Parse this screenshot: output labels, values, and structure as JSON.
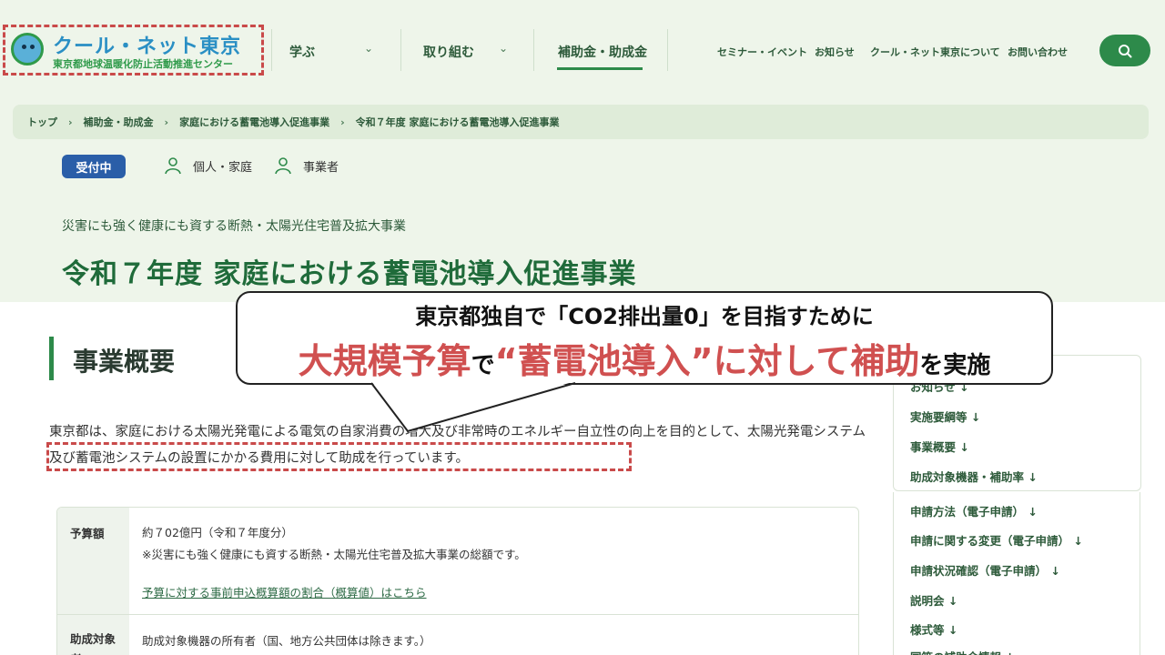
{
  "logo": {
    "title": "クール・ネット東京",
    "subtitle": "東京都地球温暖化防止活動推進センター"
  },
  "nav": {
    "items": [
      {
        "label": "学ぶ"
      },
      {
        "label": "取り組む"
      },
      {
        "label": "補助金・助成金"
      }
    ]
  },
  "utility_links": [
    "セミナー・イベント",
    "お知らせ",
    "クール・ネット東京について",
    "お問い合わせ"
  ],
  "breadcrumb": [
    "トップ",
    "補助金・助成金",
    "家庭における蓄電池導入促進事業",
    "令和７年度 家庭における蓄電池導入促進事業"
  ],
  "status_badge": "受付中",
  "targets": [
    "個人・家庭",
    "事業者"
  ],
  "hero": {
    "subtitle": "災害にも強く健康にも資する断熱・太陽光住宅普及拡大事業",
    "title": "令和７年度 家庭における蓄電池導入促進事業"
  },
  "section": {
    "title": "事業概要"
  },
  "summary": "東京都は、家庭における太陽光発電による電気の自家消費の増大及び非常時のエネルギー自立性の向上を目的として、太陽光発電システム及び蓄電池システムの設置にかかる費用に対して助成を行っています。",
  "info_table": {
    "budget_label": "予算額",
    "budget_value": "約７02億円（令和７年度分）",
    "budget_note": "※災害にも強く健康にも資する断熱・太陽光住宅普及拡大事業の総額です。",
    "budget_link": "予算に対する事前申込概算額の割合（概算値）はこちら",
    "recipient_label": "助成対象者",
    "recipient_value": "助成対象機器の所有者（国、地方公共団体は除きます。）"
  },
  "toc": [
    "お知らせ ↓",
    "実施要綱等 ↓",
    "事業概要 ↓",
    "助成対象機器・補助率 ↓",
    "申請方法（電子申請） ↓",
    "申請に関する変更（電子申請） ↓",
    "申請状況確認（電子申請） ↓",
    "説明会 ↓",
    "様式等 ↓",
    "国等の補助金情報 ↓"
  ],
  "callout": {
    "line1": "東京都独自で「CO2排出量0」を目指すために",
    "line2_a": "大規模予算",
    "line2_b": "で",
    "line2_c": "“蓄電池導入”に対して補助",
    "line2_d": "を実施"
  },
  "colors": {
    "accent_green": "#2d8a4a",
    "header_bg": "#eef5ea",
    "badge_blue": "#2a5ea8",
    "highlight_red": "#d05050"
  },
  "icons": {
    "logo": "globe-mascot-icon",
    "chevron": "chevron-down-icon",
    "search": "search-icon",
    "person": "person-icon"
  }
}
